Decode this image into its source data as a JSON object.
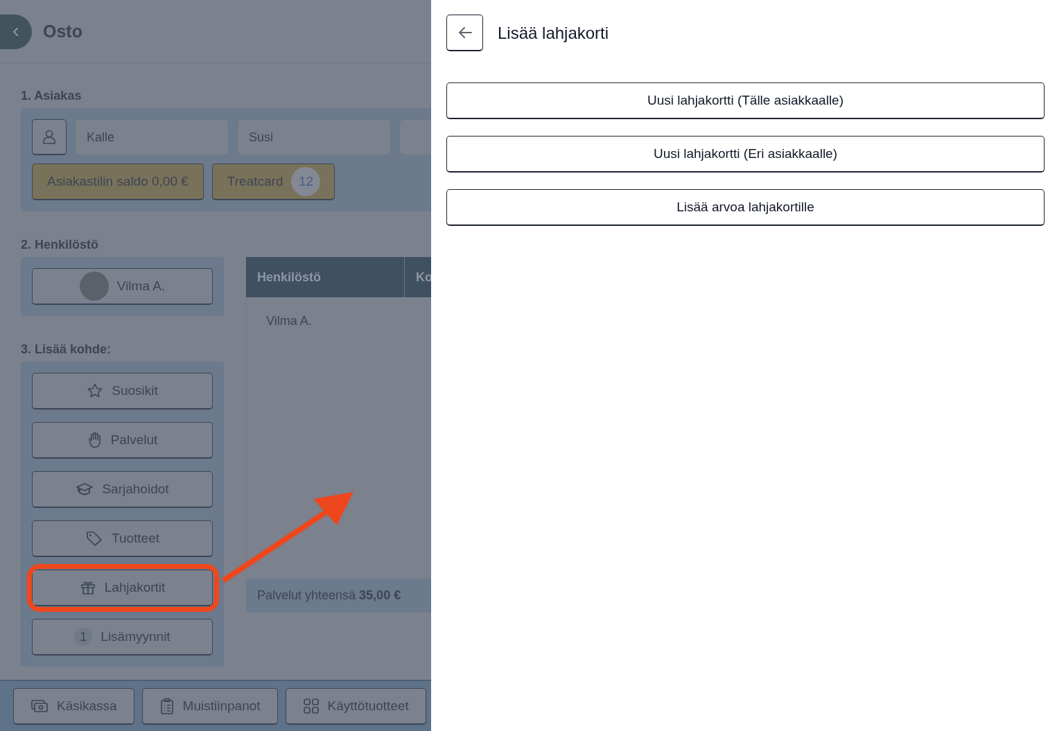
{
  "header": {
    "title": "Osto"
  },
  "customer": {
    "label": "1. Asiakas",
    "first_name": "Kalle",
    "last_name": "Susi",
    "balance_button": "Asiakastilin saldo 0,00 €",
    "treatcard": {
      "label": "Treatcard",
      "count": "12"
    }
  },
  "staff": {
    "label": "2. Henkilöstö",
    "members": [
      {
        "name": "Vilma A."
      }
    ]
  },
  "table": {
    "columns": [
      "Henkilöstö",
      "Ko"
    ],
    "rows": [
      [
        "Vilma A."
      ]
    ],
    "total": "Palvelut yhteensä **35,00 €**"
  },
  "add_item": {
    "label": "3. Lisää kohde:",
    "buttons": [
      {
        "kind": "star",
        "label": "Suosikit",
        "highlighted": false
      },
      {
        "kind": "hand",
        "label": "Palvelut",
        "highlighted": false
      },
      {
        "kind": "cap",
        "label": "Sarjahoidot",
        "highlighted": false
      },
      {
        "kind": "tag",
        "label": "Tuotteet",
        "highlighted": false
      },
      {
        "kind": "gift",
        "label": "Lahjakortit",
        "highlighted": true
      },
      {
        "kind": "badge",
        "badge": "1",
        "label": "Lisämyynnit",
        "highlighted": false
      }
    ]
  },
  "footer_buttons": [
    {
      "kind": "cash",
      "label": "Käsikassa"
    },
    {
      "kind": "clipboard",
      "label": "Muistiinpanot"
    },
    {
      "kind": "grid",
      "label": "Käyttötuotteet"
    }
  ],
  "panel": {
    "title": "Lisää lahjakorti",
    "options": [
      "Uusi lahjakortti (Tälle asiakkaalle)",
      "Uusi lahjakortti (Eri asiakkaalle)",
      "Lisää arvoa lahjakortille"
    ]
  }
}
